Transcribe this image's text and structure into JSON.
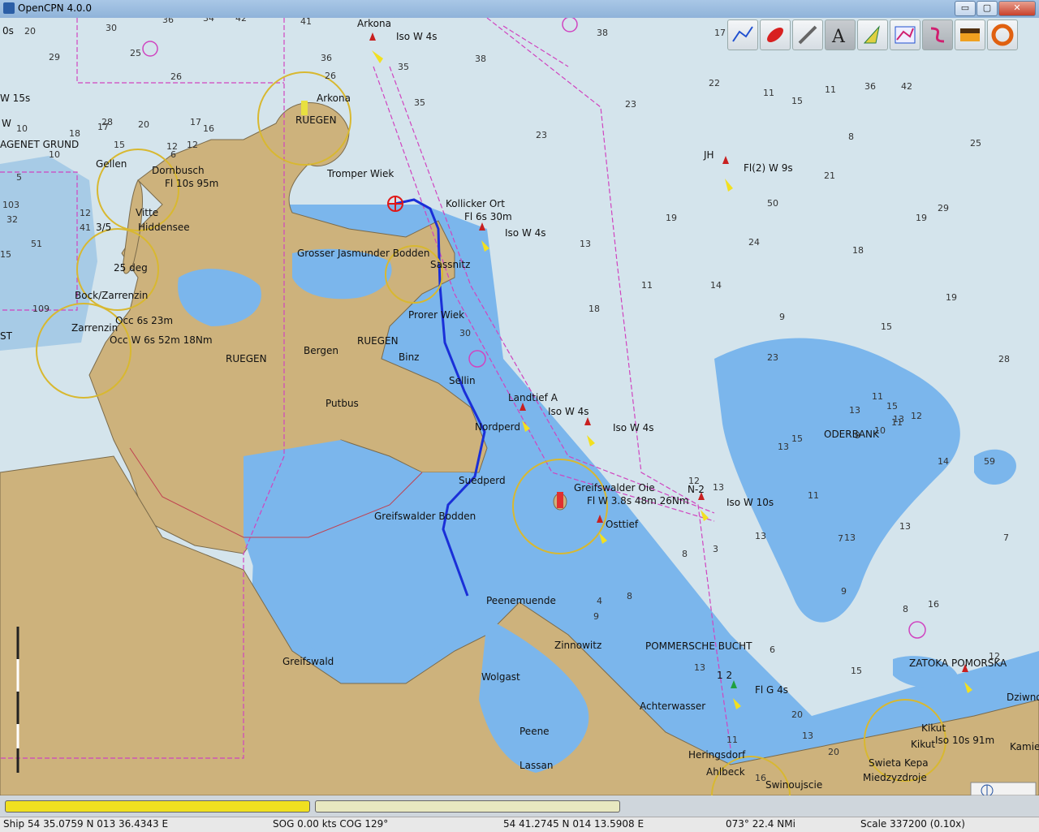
{
  "window": {
    "title": "OpenCPN 4.0.0",
    "min": "▭",
    "max": "▢",
    "close": "✕"
  },
  "toolbar": {
    "buttons": [
      {
        "name": "route-icon"
      },
      {
        "name": "track-icon"
      },
      {
        "name": "options-icon"
      },
      {
        "name": "text-icon"
      },
      {
        "name": "light-icon"
      },
      {
        "name": "ais-icon"
      },
      {
        "name": "tide-icon"
      },
      {
        "name": "day-night-icon"
      },
      {
        "name": "mob-icon"
      }
    ]
  },
  "labels": {
    "arkona_top": "Arkona",
    "iso_w_4s_1": "Iso W 4s",
    "arkona": "Arkona",
    "ruegen_n": "RUEGEN",
    "tromper_wiek": "Tromper Wiek",
    "koellicker_ort": "Kollicker Ort",
    "fl_6s_30m": "Fl 6s 30m",
    "iso_w_4s_2": "Iso W 4s",
    "grosser_jasmunder": "Grosser Jasmunder Bodden",
    "sassnitz": "Sassnitz",
    "prorer_wiek": "Prorer Wiek",
    "gellen": "Gellen",
    "dornbusch": "Dornbusch",
    "fl_10s_95m": "Fl 10s 95m",
    "vitte": "Vitte",
    "hiddensee": "Hiddensee",
    "deg": "25 deg",
    "bock": "Bock/Zarrenzin",
    "occ_6s": "Occ 6s 23m",
    "zarrenzin": "Zarrenzin",
    "occ_w": "Occ W 6s 52m 18Nm",
    "ruegen_w": "RUEGEN",
    "bergen": "Bergen",
    "ruegen_c": "RUEGEN",
    "binz": "Binz",
    "sellin": "Sellin",
    "putbus": "Putbus",
    "landtief": "Landtief A",
    "iso_w_4s_3": "Iso W 4s",
    "iso_w_4s_4": "Iso W 4s",
    "nordperd": "Nordperd",
    "suedperd": "Suedperd",
    "greifswalder_oie": "Greifswalder Oie",
    "fl_w_38": "Fl W 3.8s 48m 26Nm",
    "greifswalder_bodden": "Greifswalder Bodden",
    "osttief": "Osttief",
    "n2": "N-2",
    "iso_w_10s": "Iso W 10s",
    "peenemuende": "Peenemuende",
    "greifswald": "Greifswald",
    "zinnowitz": "Zinnowitz",
    "pommersche_bucht": "POMMERSCHE BUCHT",
    "wolgast": "Wolgast",
    "achterwasser": "Achterwasser",
    "fl_g_4s": "Fl G 4s",
    "peene": "Peene",
    "lassan": "Lassan",
    "heringsdorf": "Heringsdorf",
    "ahlbeck": "Ahlbeck",
    "swinoujscie": "Swinoujscie",
    "jh": "JH",
    "fl2_w_9s": "Fl(2) W 9s",
    "oderbank": "ODERBANK",
    "zatoka": "ZATOKA POMORSKA",
    "dziwnow": "Dziwnow",
    "kikut": "Kikut",
    "kikut2": "Kikut",
    "iso_10s_91m": "Iso 10s 91m",
    "swieta_kepa": "Swieta Kepa",
    "miedzyzdroje": "Miedzyzdroje",
    "kamien": "Kamien",
    "w_15s": "W 15s",
    "w_frag": "W",
    "agenet_grund": "AGENET GRUND",
    "os": "0s",
    "st": "ST",
    "one_two": "1 2",
    "three_five": "3/5"
  },
  "depths": [
    "20",
    "30",
    "36",
    "34",
    "42",
    "41",
    "38",
    "17",
    "29",
    "25",
    "26",
    "36",
    "35",
    "38",
    "22",
    "23",
    "11",
    "15",
    "11",
    "36",
    "42",
    "8",
    "10",
    "28",
    "20",
    "17",
    "18",
    "16",
    "6",
    "12",
    "17",
    "12",
    "10",
    "15",
    "5",
    "26",
    "35",
    "23",
    "25",
    "21",
    "50",
    "29",
    "19",
    "24",
    "18",
    "19",
    "19",
    "9",
    "15",
    "28",
    "23",
    "13",
    "11",
    "18",
    "14",
    "14",
    "15",
    "11",
    "15",
    "12",
    "13",
    "11",
    "13",
    "13",
    "8",
    "9",
    "7",
    "8",
    "8",
    "6",
    "13",
    "15",
    "20",
    "16",
    "13",
    "16",
    "12",
    "11",
    "12",
    "13",
    "13",
    "11",
    "13",
    "9",
    "10",
    "13",
    "3",
    "20",
    "7",
    "9",
    "4",
    "59",
    "51",
    "109",
    "103",
    "32",
    "12",
    "41",
    "15",
    "30"
  ],
  "status": {
    "ship": "Ship 54 35.0759 N   013 36.4343 E",
    "sog": "SOG 0.00 kts  COG 129°",
    "cursor": "54 41.2745 N   014 13.5908 E",
    "brg": "073°  22.4 NMi",
    "scale": "Scale 337200 (0.10x)"
  }
}
